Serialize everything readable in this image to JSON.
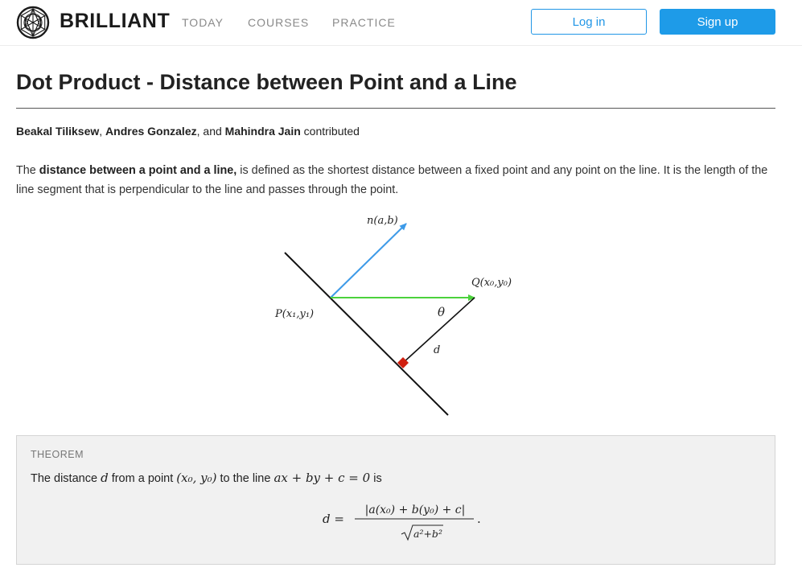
{
  "header": {
    "brand": "BRILLIANT",
    "logo_icon": "brilliant-logo-icon",
    "nav": {
      "today": "TODAY",
      "courses": "COURSES",
      "practice": "PRACTICE"
    },
    "login_label": "Log in",
    "signup_label": "Sign up",
    "accent_color": "#1e9be8"
  },
  "article": {
    "title": "Dot Product - Distance between Point and a Line",
    "contributors": {
      "names": [
        "Beakal Tiliksew",
        "Andres Gonzalez",
        "Mahindra Jain"
      ],
      "sep1": ", ",
      "sep2": ", and ",
      "suffix": " contributed"
    },
    "intro": {
      "prefix": "The ",
      "bold": "distance between a point and a line,",
      "rest": " is defined as the shortest distance between a fixed point and any point on the line. It is the length of the line segment that is perpendicular to the line and passes through the point."
    }
  },
  "diagram": {
    "normal_label": "n(a,b)",
    "point_p_label": "P(x₁,y₁)",
    "point_q_label": "Q(x₀,y₀)",
    "theta_label": "θ",
    "d_label": "d",
    "colors": {
      "normal": "#3d9ae8",
      "pq": "#4bd23c",
      "right_angle": "#d02010",
      "line": "#111111"
    }
  },
  "theorem": {
    "label": "THEOREM",
    "s1": "The distance ",
    "d": "d",
    "s2": " from a point ",
    "point": "(x₀, y₀)",
    "s3": " to the line ",
    "line_eq": "ax + by + c = 0",
    "s4": " is",
    "formula_lhs": "d =",
    "formula_num": "|a(x₀) + b(y₀) + c|",
    "formula_den": "a²+b²",
    "formula_end": "."
  }
}
